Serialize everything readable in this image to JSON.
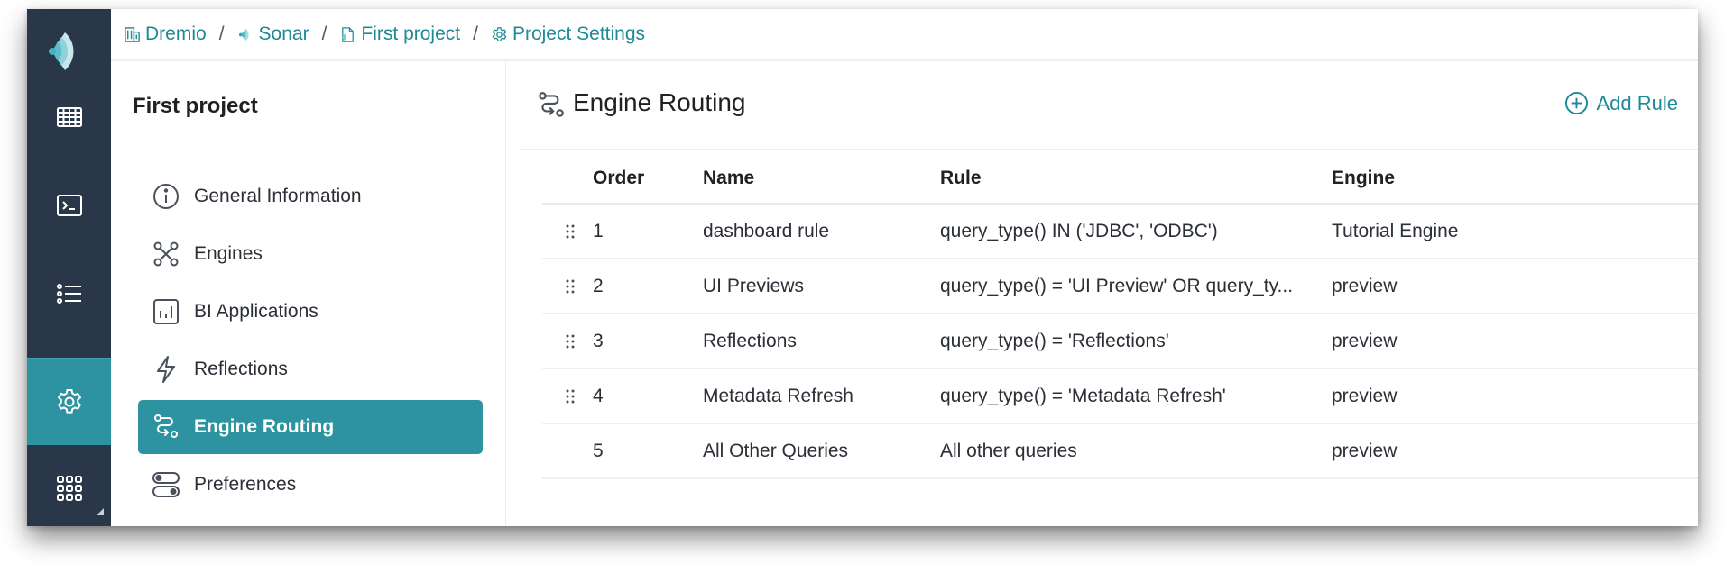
{
  "app": {
    "logo": "dremio-logo-icon"
  },
  "nav": {
    "items": [
      {
        "name": "datasets",
        "icon": "grid-table-icon",
        "active": false
      },
      {
        "name": "sql-runner",
        "icon": "terminal-icon",
        "active": false
      },
      {
        "name": "jobs",
        "icon": "list-icon",
        "active": false
      },
      {
        "name": "settings",
        "icon": "gear-icon",
        "active": true
      },
      {
        "name": "apps",
        "icon": "app-grid-icon",
        "active": false
      }
    ]
  },
  "breadcrumb": {
    "items": [
      {
        "label": "Dremio",
        "icon": "building-icon"
      },
      {
        "label": "Sonar",
        "icon": "sonar-icon"
      },
      {
        "label": "First project",
        "icon": "project-file-icon"
      },
      {
        "label": "Project Settings",
        "icon": "gear-icon"
      }
    ],
    "separator": "/"
  },
  "menu": {
    "title": "First project",
    "items": [
      {
        "label": "General Information",
        "icon": "info-icon",
        "active": false
      },
      {
        "label": "Engines",
        "icon": "engines-icon",
        "active": false
      },
      {
        "label": "BI Applications",
        "icon": "bar-chart-icon",
        "active": false
      },
      {
        "label": "Reflections",
        "icon": "lightning-icon",
        "active": false
      },
      {
        "label": "Engine Routing",
        "icon": "routing-icon",
        "active": true
      },
      {
        "label": "Preferences",
        "icon": "toggles-icon",
        "active": false
      }
    ]
  },
  "main": {
    "title": "Engine Routing",
    "add_rule_label": "Add Rule",
    "table": {
      "columns": [
        "Order",
        "Name",
        "Rule",
        "Engine"
      ],
      "rows": [
        {
          "order": "1",
          "name": "dashboard rule",
          "rule": "query_type() IN ('JDBC', 'ODBC')",
          "engine": "Tutorial Engine",
          "draggable": true
        },
        {
          "order": "2",
          "name": "UI Previews",
          "rule": "query_type() = 'UI Preview' OR query_ty...",
          "engine": "preview",
          "draggable": true
        },
        {
          "order": "3",
          "name": "Reflections",
          "rule": "query_type() = 'Reflections'",
          "engine": "preview",
          "draggable": true
        },
        {
          "order": "4",
          "name": "Metadata Refresh",
          "rule": "query_type() = 'Metadata Refresh'",
          "engine": "preview",
          "draggable": true
        },
        {
          "order": "5",
          "name": "All Other Queries",
          "rule": "All other queries",
          "engine": "preview",
          "draggable": false
        }
      ]
    }
  },
  "colors": {
    "nav_bg": "#2a3749",
    "accent": "#2e93a0",
    "link": "#1e8a96"
  }
}
